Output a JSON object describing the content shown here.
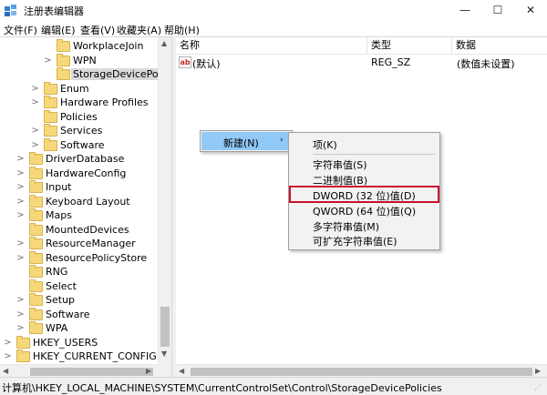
{
  "window": {
    "title": "注册表编辑器",
    "minimize": "—",
    "maximize": "☐",
    "close": "✕"
  },
  "menubar": {
    "items": [
      "文件(F)",
      "编辑(E)",
      "查看(V)",
      "收藏夹(A)",
      "帮助(H)"
    ]
  },
  "tree": {
    "items": [
      {
        "label": "WorkplaceJoin",
        "expander": "",
        "level": 3,
        "selected": false
      },
      {
        "label": "WPN",
        "expander": ">",
        "level": 3,
        "selected": false
      },
      {
        "label": "StorageDevicePolicies",
        "expander": "",
        "level": 3,
        "selected": true
      },
      {
        "label": "Enum",
        "expander": ">",
        "level": 2,
        "selected": false
      },
      {
        "label": "Hardware Profiles",
        "expander": ">",
        "level": 2,
        "selected": false
      },
      {
        "label": "Policies",
        "expander": "",
        "level": 2,
        "selected": false
      },
      {
        "label": "Services",
        "expander": ">",
        "level": 2,
        "selected": false
      },
      {
        "label": "Software",
        "expander": ">",
        "level": 2,
        "selected": false
      },
      {
        "label": "DriverDatabase",
        "expander": ">",
        "level": 1,
        "selected": false
      },
      {
        "label": "HardwareConfig",
        "expander": ">",
        "level": 1,
        "selected": false
      },
      {
        "label": "Input",
        "expander": ">",
        "level": 1,
        "selected": false
      },
      {
        "label": "Keyboard Layout",
        "expander": ">",
        "level": 1,
        "selected": false
      },
      {
        "label": "Maps",
        "expander": ">",
        "level": 1,
        "selected": false
      },
      {
        "label": "MountedDevices",
        "expander": "",
        "level": 1,
        "selected": false
      },
      {
        "label": "ResourceManager",
        "expander": ">",
        "level": 1,
        "selected": false
      },
      {
        "label": "ResourcePolicyStore",
        "expander": ">",
        "level": 1,
        "selected": false
      },
      {
        "label": "RNG",
        "expander": "",
        "level": 1,
        "selected": false
      },
      {
        "label": "Select",
        "expander": "",
        "level": 1,
        "selected": false
      },
      {
        "label": "Setup",
        "expander": ">",
        "level": 1,
        "selected": false
      },
      {
        "label": "Software",
        "expander": ">",
        "level": 1,
        "selected": false
      },
      {
        "label": "WPA",
        "expander": ">",
        "level": 1,
        "selected": false
      },
      {
        "label": "HKEY_USERS",
        "expander": ">",
        "level": 0,
        "selected": false
      },
      {
        "label": "HKEY_CURRENT_CONFIG",
        "expander": ">",
        "level": 0,
        "selected": false
      }
    ]
  },
  "list": {
    "columns": [
      "名称",
      "类型",
      "数据"
    ],
    "rows": [
      {
        "icon_text": "ab",
        "name": "(默认)",
        "type": "REG_SZ",
        "data": "(数值未设置)"
      }
    ]
  },
  "context_menu": {
    "parent_label": "新建(N)",
    "parent_arrow": "›",
    "items": [
      {
        "label": "项(K)",
        "highlighted": false
      },
      {
        "label": "字符串值(S)",
        "highlighted": false
      },
      {
        "label": "二进制值(B)",
        "highlighted": false
      },
      {
        "label": "DWORD (32 位)值(D)",
        "highlighted": true
      },
      {
        "label": "QWORD (64 位)值(Q)",
        "highlighted": false
      },
      {
        "label": "多字符串值(M)",
        "highlighted": false
      },
      {
        "label": "可扩充字符串值(E)",
        "highlighted": false
      }
    ],
    "highlight_color": "#c8102e"
  },
  "statusbar": {
    "path": "计算机\\HKEY_LOCAL_MACHINE\\SYSTEM\\CurrentControlSet\\Control\\StorageDevicePolicies"
  },
  "colors": {
    "folder": "#f6d87a",
    "menu_hover": "#91c9f7",
    "selection": "#d9d9d9"
  },
  "icons": {
    "app": "registry-editor-icon",
    "folder": "folder-icon",
    "string_value": "string-value-icon"
  }
}
